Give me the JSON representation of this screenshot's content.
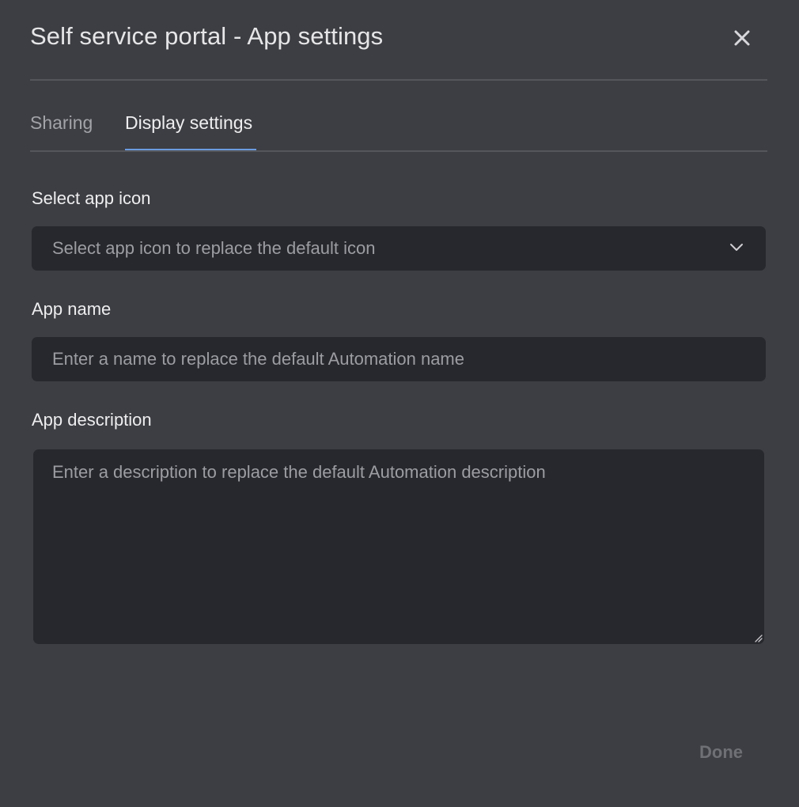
{
  "dialog": {
    "title": "Self service portal - App settings",
    "close_icon": "close-icon"
  },
  "tabs": [
    {
      "label": "Sharing",
      "active": false
    },
    {
      "label": "Display settings",
      "active": true
    }
  ],
  "form": {
    "app_icon": {
      "label": "Select app icon",
      "placeholder": "Select app icon to replace the default icon",
      "icon": "chevron-down-icon"
    },
    "app_name": {
      "label": "App name",
      "placeholder": "Enter a name to replace the default Automation name",
      "value": ""
    },
    "app_description": {
      "label": "App description",
      "placeholder": "Enter a description to replace the default Automation description",
      "value": ""
    }
  },
  "footer": {
    "done_label": "Done"
  },
  "colors": {
    "background": "#3d3e43",
    "field_background": "#27282d",
    "accent": "#6b9be0"
  }
}
